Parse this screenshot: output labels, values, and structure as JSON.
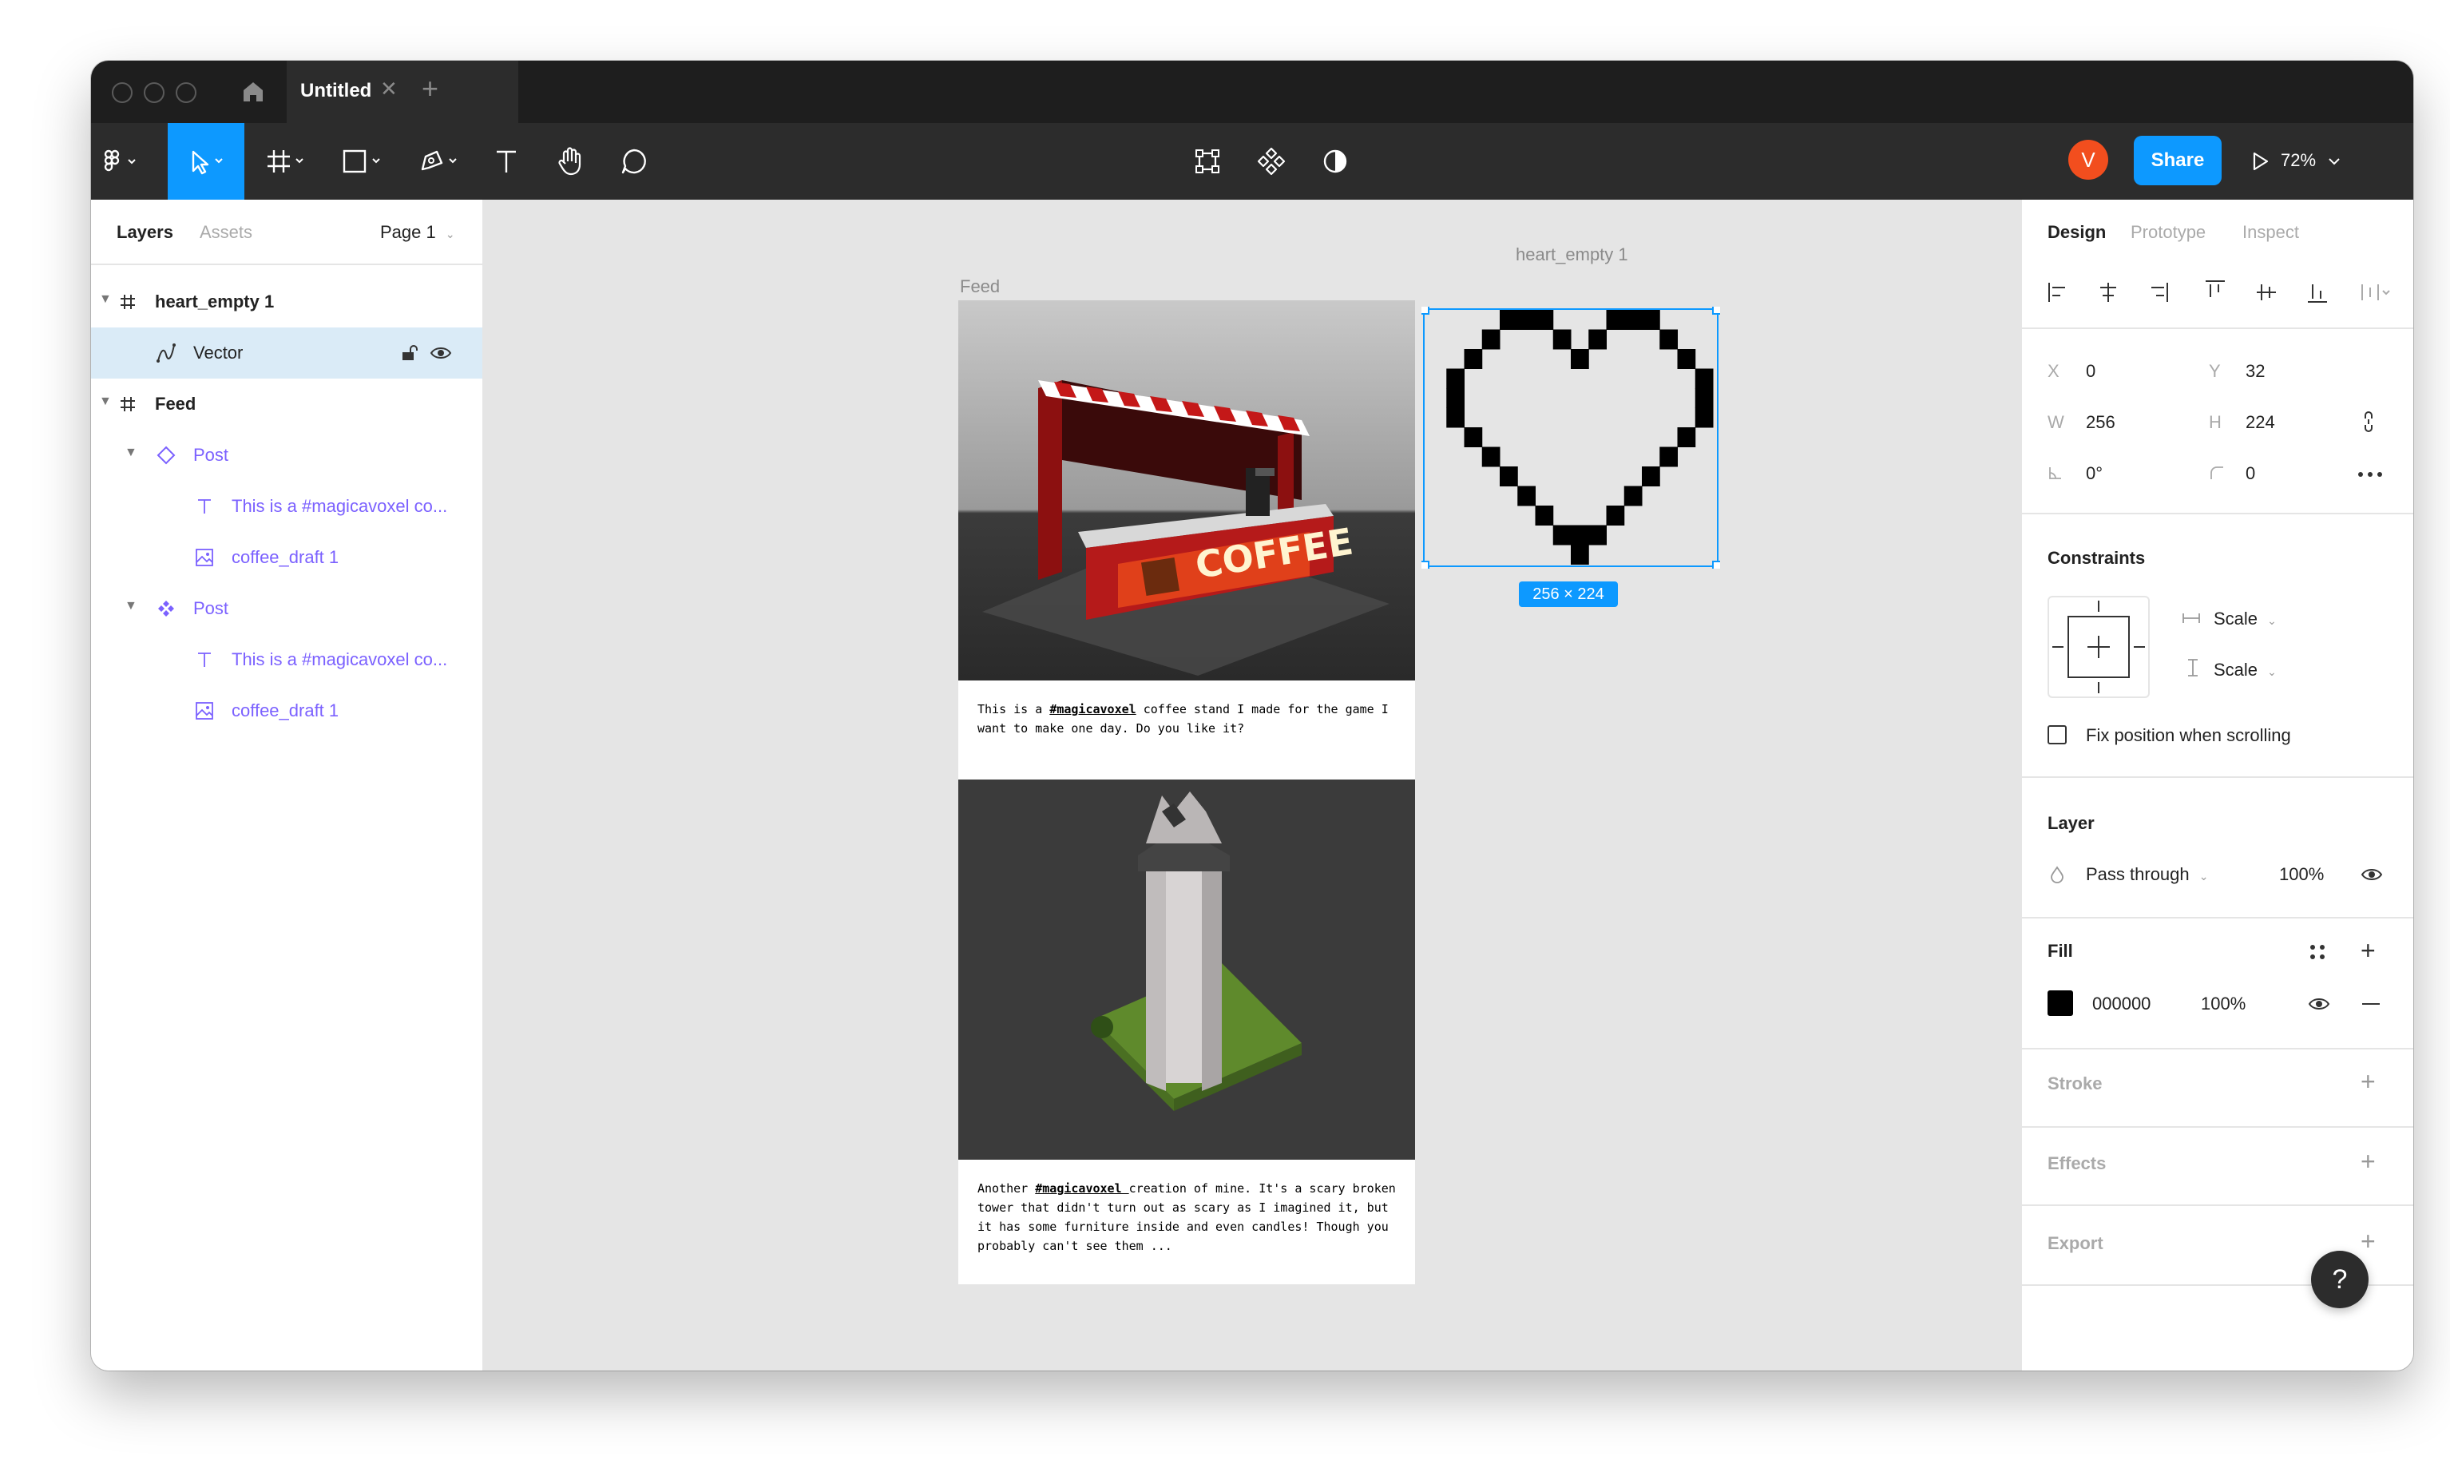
{
  "titlebar": {
    "tab_title": "Untitled",
    "close_glyph": "✕",
    "add_glyph": "+"
  },
  "toolbar": {
    "avatar_initial": "V",
    "share_label": "Share",
    "zoom_level": "72%",
    "active_tool": "move-tool"
  },
  "left_panel": {
    "tabs": [
      "Layers",
      "Assets"
    ],
    "page_selector": "Page 1",
    "layers": [
      {
        "name": "heart_empty 1",
        "kind": "frame"
      },
      {
        "name": "Vector",
        "kind": "vector",
        "selected": true
      },
      {
        "name": "Feed",
        "kind": "frame"
      },
      {
        "name": "Post",
        "kind": "instance"
      },
      {
        "name": "This is a #magicavoxel co...",
        "kind": "text"
      },
      {
        "name": "coffee_draft 1",
        "kind": "image"
      },
      {
        "name": "Post",
        "kind": "component"
      },
      {
        "name": "This is a #magicavoxel co...",
        "kind": "text"
      },
      {
        "name": "coffee_draft 1",
        "kind": "image"
      }
    ]
  },
  "canvas": {
    "frame_labels": {
      "heart": "heart_empty 1",
      "feed": "Feed"
    },
    "selection_size": "256 × 224",
    "posts": [
      {
        "caption_pre": "This is a ",
        "tag": "#magicavoxel",
        "caption_post": " coffee stand I made for the game I want to make one day. Do you like it?",
        "sign": "COFFEE"
      },
      {
        "caption_pre": "Another ",
        "tag": "#magicavoxel ",
        "caption_post": "creation of mine. It's a scary broken tower that didn't turn out as scary as I imagined it, but it has some furniture inside and even candles! Though you probably can't see them ..."
      }
    ]
  },
  "right_panel": {
    "tabs": [
      "Design",
      "Prototype",
      "Inspect"
    ],
    "position": {
      "x_label": "X",
      "x": "0",
      "y_label": "Y",
      "y": "32"
    },
    "size": {
      "w_label": "W",
      "w": "256",
      "h_label": "H",
      "h": "224"
    },
    "rotation": "0°",
    "corner_radius": "0",
    "constraints": {
      "title": "Constraints",
      "horizontal": "Scale",
      "vertical": "Scale",
      "fix_position_label": "Fix position when scrolling"
    },
    "layer": {
      "title": "Layer",
      "blend": "Pass through",
      "opacity": "100%"
    },
    "fill": {
      "title": "Fill",
      "hex": "000000",
      "opacity": "100%",
      "color": "#000000"
    },
    "stroke_title": "Stroke",
    "effects_title": "Effects",
    "export_title": "Export",
    "help_glyph": "?"
  },
  "colors": {
    "accent": "#0d99ff",
    "avatar": "#f24e1e",
    "component_purple": "#7b61ff",
    "selection_row": "#daebf7"
  }
}
